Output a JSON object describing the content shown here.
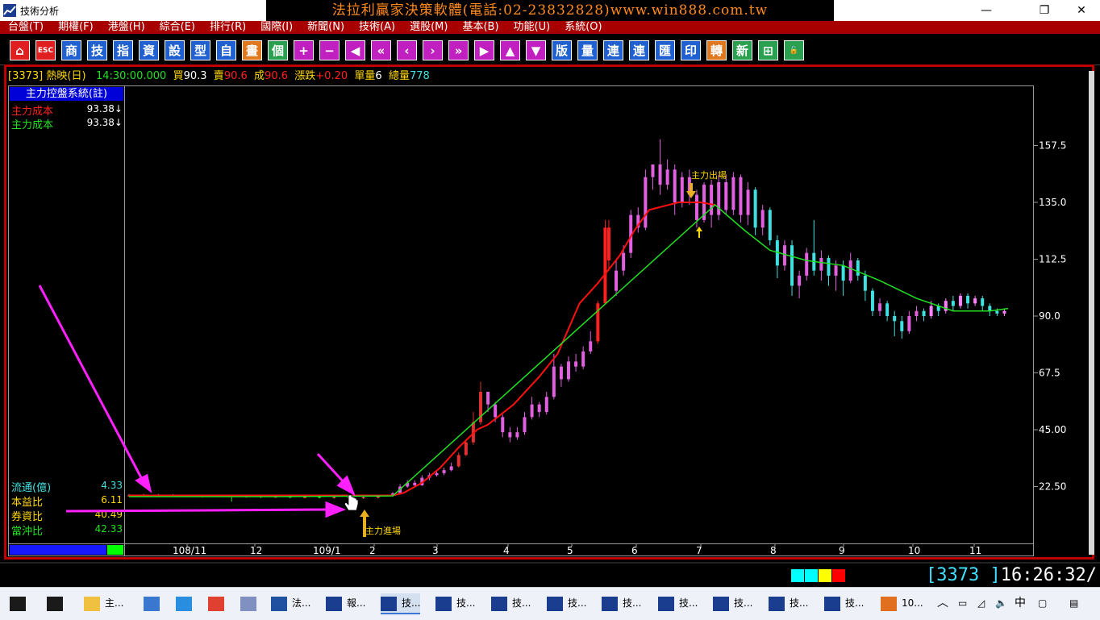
{
  "window": {
    "title": "技術分析",
    "banner": "法拉利贏家決策軟體(電話:02-23832828)www.win888.com.tw",
    "min": "—",
    "max": "❐",
    "close": "✕"
  },
  "menu": [
    "台盤(T)",
    "期權(F)",
    "港盤(H)",
    "綜合(E)",
    "排行(R)",
    "國際(I)",
    "新聞(N)",
    "技術(A)",
    "選股(M)",
    "基本(B)",
    "功能(U)",
    "系統(O)"
  ],
  "toolbar": [
    {
      "name": "home",
      "label": "⌂",
      "bg": "#e02020"
    },
    {
      "name": "esc",
      "label": "ESC",
      "bg": "#e02020"
    },
    {
      "name": "shang",
      "label": "商",
      "bg": "#2060d0"
    },
    {
      "name": "tech-list",
      "label": "技",
      "bg": "#2060d0"
    },
    {
      "name": "indicators",
      "label": "指",
      "bg": "#2060d0"
    },
    {
      "name": "zi",
      "label": "資",
      "bg": "#2060d0"
    },
    {
      "name": "settings",
      "label": "設",
      "bg": "#2060d0"
    },
    {
      "name": "pattern",
      "label": "型",
      "bg": "#2060d0"
    },
    {
      "name": "zi2",
      "label": "自",
      "bg": "#2060d0"
    },
    {
      "name": "draw",
      "label": "畫",
      "bg": "#e07820"
    },
    {
      "name": "qi",
      "label": "個",
      "bg": "#2aa050"
    },
    {
      "name": "plus",
      "label": "+",
      "bg": "#c020c0"
    },
    {
      "name": "minus",
      "label": "−",
      "bg": "#c020c0"
    },
    {
      "name": "left-end",
      "label": "◀",
      "bg": "#c020c0"
    },
    {
      "name": "fast-back",
      "label": "«",
      "bg": "#c020c0"
    },
    {
      "name": "back",
      "label": "‹",
      "bg": "#c020c0"
    },
    {
      "name": "forward",
      "label": "›",
      "bg": "#c020c0"
    },
    {
      "name": "fast-forward",
      "label": "»",
      "bg": "#c020c0"
    },
    {
      "name": "right-end",
      "label": "▶",
      "bg": "#c020c0"
    },
    {
      "name": "up",
      "label": "▲",
      "bg": "#c020c0"
    },
    {
      "name": "down",
      "label": "▼",
      "bg": "#c020c0"
    },
    {
      "name": "layout",
      "label": "版",
      "bg": "#2060d0"
    },
    {
      "name": "vol",
      "label": "量",
      "bg": "#2060d0"
    },
    {
      "name": "lian1",
      "label": "連",
      "bg": "#2060d0"
    },
    {
      "name": "lian2",
      "label": "連",
      "bg": "#2060d0"
    },
    {
      "name": "hui",
      "label": "匯",
      "bg": "#2060d0"
    },
    {
      "name": "print",
      "label": "印",
      "bg": "#2060d0"
    },
    {
      "name": "zhuan",
      "label": "轉",
      "bg": "#e07820"
    },
    {
      "name": "xin",
      "label": "新",
      "bg": "#2aa050"
    },
    {
      "name": "window",
      "label": "⊞",
      "bg": "#2aa050"
    },
    {
      "name": "lock",
      "label": "🔓",
      "bg": "#2aa050"
    }
  ],
  "quote": {
    "code": "[3373]",
    "name": "熱映",
    "period": "(日)",
    "time": "14:30:00.000",
    "bid_label": "買",
    "bid": "90.3",
    "ask_label": "賣",
    "ask": "90.6",
    "deal_label": "成",
    "deal": "90.6",
    "change_label": "漲跌",
    "change": "+0.20",
    "unit_vol_label": "單量",
    "unit_vol": "6",
    "total_vol_label": "總量",
    "total_vol": "778"
  },
  "panel": {
    "title": "主力控盤系統(註)",
    "lines": [
      {
        "label": "主力成本",
        "value": "93.38↓",
        "color": "#ff2020"
      },
      {
        "label": "主力成本",
        "value": "93.38↓",
        "color": "#20e020"
      }
    ],
    "stats": [
      {
        "label": "流通(億)",
        "value": "4.33"
      },
      {
        "label": "本益比",
        "value": "6.11"
      },
      {
        "label": "券資比",
        "value": "40.49"
      },
      {
        "label": "當沖比",
        "value": "42.33"
      }
    ]
  },
  "annotations": {
    "enter": "主力進場",
    "exit": "主力出場"
  },
  "status": {
    "code": "[3373   ]",
    "time": "16:26:32/"
  },
  "colors": {
    "menu_bg": "#a80000",
    "frame": "#bf0000",
    "up_candle": "#e060e0",
    "down_candle": "#40e0e0",
    "red_line": "#ff1010",
    "green_line": "#20e020",
    "arrow": "#ff20ff",
    "marker": "#e8b020"
  },
  "taskbar": [
    {
      "name": "start",
      "label": "",
      "icon": "windows-icon"
    },
    {
      "name": "task-view",
      "label": "",
      "icon": "task-view-icon"
    },
    {
      "name": "explorer",
      "label": "主...",
      "icon": "folder-icon"
    },
    {
      "name": "pc",
      "label": "",
      "icon": "computer-icon"
    },
    {
      "name": "ie",
      "label": "",
      "icon": "ie-icon"
    },
    {
      "name": "chrome",
      "label": "",
      "icon": "chrome-icon"
    },
    {
      "name": "tool",
      "label": "",
      "icon": "tool-icon"
    },
    {
      "name": "fa",
      "label": "法...",
      "icon": "app-icon"
    },
    {
      "name": "bao",
      "label": "報...",
      "icon": "chart-icon"
    },
    {
      "name": "ji1",
      "label": "技...",
      "icon": "chart-icon"
    },
    {
      "name": "ji2",
      "label": "技...",
      "icon": "chart-icon"
    },
    {
      "name": "ji3",
      "label": "技...",
      "icon": "chart-icon"
    },
    {
      "name": "ji4",
      "label": "技...",
      "icon": "chart-icon"
    },
    {
      "name": "ji5",
      "label": "技...",
      "icon": "chart-icon"
    },
    {
      "name": "ji6",
      "label": "技...",
      "icon": "chart-icon"
    },
    {
      "name": "ji7",
      "label": "技...",
      "icon": "chart-icon"
    },
    {
      "name": "ji8",
      "label": "技...",
      "icon": "chart-icon"
    },
    {
      "name": "ji9",
      "label": "技...",
      "icon": "chart-icon"
    },
    {
      "name": "ten",
      "label": "10...",
      "icon": "office-icon"
    }
  ],
  "tray": {
    "ime": "中"
  },
  "chart_data": {
    "type": "candlestick",
    "y_ticks": [
      "22.50",
      "45.00",
      "67.5",
      "90.0",
      "112.5",
      "135.0",
      "157.5"
    ],
    "x_ticks": [
      "108/11",
      "12",
      "109/1",
      "2",
      "3",
      "4",
      "5",
      "6",
      "7",
      "8",
      "9",
      "10",
      "11"
    ],
    "ylim": [
      0,
      180
    ],
    "grid": false,
    "legend": "none",
    "red_line": [
      [
        0,
        19
      ],
      [
        20,
        19
      ],
      [
        40,
        19
      ],
      [
        60,
        19
      ],
      [
        72,
        19
      ],
      [
        75,
        20
      ],
      [
        80,
        24
      ],
      [
        85,
        30
      ],
      [
        90,
        38
      ],
      [
        95,
        45
      ],
      [
        98,
        47
      ],
      [
        105,
        55
      ],
      [
        112,
        66
      ],
      [
        117,
        75
      ],
      [
        120,
        85
      ],
      [
        123,
        95
      ],
      [
        128,
        103
      ],
      [
        134,
        114
      ],
      [
        138,
        124
      ],
      [
        142,
        132
      ],
      [
        150,
        135
      ],
      [
        156,
        135
      ],
      [
        160,
        134
      ]
    ],
    "green_line": [
      [
        0,
        18.5
      ],
      [
        40,
        18.5
      ],
      [
        72,
        18.8
      ],
      [
        160,
        134
      ],
      [
        168,
        124
      ],
      [
        175,
        116
      ],
      [
        185,
        112
      ],
      [
        195,
        110
      ],
      [
        205,
        104
      ],
      [
        215,
        97
      ],
      [
        225,
        92
      ],
      [
        235,
        92
      ],
      [
        240,
        93
      ]
    ],
    "candles": [
      [
        0,
        19,
        19,
        19.6,
        18.6
      ],
      [
        4,
        19,
        19,
        19.6,
        18.6
      ],
      [
        8,
        19,
        19,
        19.6,
        18.6
      ],
      [
        12,
        19,
        18.8,
        19.5,
        18.4
      ],
      [
        16,
        18.8,
        18.9,
        19.3,
        18.4
      ],
      [
        20,
        18.9,
        18.7,
        19.3,
        18.2
      ],
      [
        24,
        18.7,
        18.8,
        19.2,
        18.3
      ],
      [
        28,
        18.8,
        18.5,
        19.2,
        16.5
      ],
      [
        32,
        18.5,
        18.6,
        19,
        18.1
      ],
      [
        36,
        18.6,
        18.4,
        19,
        18
      ],
      [
        40,
        18.4,
        18.5,
        18.9,
        18
      ],
      [
        44,
        18.5,
        18.3,
        18.9,
        17.9
      ],
      [
        48,
        18.3,
        18.4,
        18.8,
        17.9
      ],
      [
        52,
        18.4,
        18.2,
        18.8,
        17.8
      ],
      [
        56,
        18.2,
        18.3,
        18.7,
        17.8
      ],
      [
        60,
        18.3,
        18.1,
        18.7,
        17.7
      ],
      [
        64,
        18.1,
        18.2,
        18.6,
        17.7
      ],
      [
        68,
        18.2,
        18.8,
        19.2,
        17.8
      ],
      [
        72,
        18.8,
        19.8,
        20.3,
        18.5
      ],
      [
        74,
        19.8,
        22.5,
        23.5,
        19.5
      ],
      [
        76,
        22.5,
        24,
        25,
        22
      ],
      [
        78,
        24,
        23,
        25,
        22.5
      ],
      [
        80,
        23,
        26,
        27,
        22.8
      ],
      [
        82,
        26,
        27,
        28,
        25
      ],
      [
        84,
        27,
        27.8,
        28.5,
        26.5
      ],
      [
        86,
        27.8,
        29,
        30,
        27
      ],
      [
        88,
        29,
        30.5,
        32,
        28.5
      ],
      [
        90,
        30.5,
        35,
        36,
        30
      ],
      [
        92,
        35,
        40,
        41,
        34.5
      ],
      [
        94,
        40,
        48,
        52,
        39
      ],
      [
        96,
        48,
        60,
        64,
        47
      ],
      [
        98,
        60,
        55,
        60,
        52
      ],
      [
        100,
        55,
        50,
        56,
        48
      ],
      [
        102,
        50,
        44,
        51,
        42
      ],
      [
        104,
        44,
        42,
        46,
        40
      ],
      [
        106,
        42,
        44,
        46,
        41
      ],
      [
        108,
        44,
        50,
        52,
        43
      ],
      [
        110,
        50,
        55,
        58,
        49
      ],
      [
        112,
        55,
        52,
        56,
        50
      ],
      [
        114,
        52,
        58,
        60,
        51
      ],
      [
        116,
        58,
        70,
        75,
        57
      ],
      [
        118,
        70,
        65,
        71,
        62
      ],
      [
        120,
        65,
        72,
        74,
        64
      ],
      [
        122,
        72,
        70,
        75,
        68
      ],
      [
        124,
        70,
        76,
        78,
        69
      ],
      [
        126,
        76,
        80,
        84,
        75
      ],
      [
        128,
        80,
        95,
        96,
        79
      ],
      [
        130,
        95,
        125,
        128,
        108
      ],
      [
        131,
        125,
        112,
        128,
        108
      ],
      [
        133,
        100,
        108,
        112,
        98
      ],
      [
        135,
        108,
        115,
        118,
        106
      ],
      [
        137,
        115,
        130,
        132,
        113
      ],
      [
        139,
        130,
        125,
        133,
        123
      ],
      [
        141,
        125,
        145,
        148,
        124
      ],
      [
        143,
        145,
        150,
        150,
        140
      ],
      [
        145,
        150,
        142,
        160,
        138
      ],
      [
        147,
        142,
        148,
        152,
        140
      ],
      [
        149,
        148,
        135,
        150,
        130
      ],
      [
        151,
        135,
        145,
        147,
        133
      ],
      [
        153,
        145,
        138,
        148,
        134
      ],
      [
        155,
        138,
        128,
        140,
        125
      ],
      [
        157,
        128,
        142,
        143,
        127
      ],
      [
        159,
        142,
        130,
        144,
        125
      ],
      [
        161,
        130,
        143,
        146,
        128
      ],
      [
        163,
        143,
        132,
        146,
        130
      ],
      [
        165,
        132,
        145,
        147,
        130
      ],
      [
        167,
        145,
        130,
        146,
        127
      ],
      [
        169,
        130,
        140,
        143,
        126
      ],
      [
        171,
        140,
        125,
        141,
        122
      ],
      [
        173,
        125,
        132,
        134,
        122
      ],
      [
        175,
        132,
        120,
        133,
        118
      ],
      [
        177,
        120,
        110,
        122,
        105
      ],
      [
        179,
        110,
        118,
        120,
        108
      ],
      [
        181,
        118,
        102,
        120,
        98
      ],
      [
        183,
        102,
        106,
        108,
        97
      ],
      [
        185,
        106,
        115,
        117,
        104
      ],
      [
        187,
        115,
        108,
        128,
        106
      ],
      [
        189,
        108,
        113,
        116,
        104
      ],
      [
        191,
        113,
        106,
        114,
        102
      ],
      [
        193,
        106,
        110,
        112,
        100
      ],
      [
        195,
        110,
        104,
        112,
        98
      ],
      [
        197,
        104,
        112,
        115,
        103
      ],
      [
        199,
        112,
        106,
        113,
        104
      ],
      [
        201,
        106,
        100,
        108,
        96
      ],
      [
        203,
        100,
        92,
        101,
        90
      ],
      [
        205,
        92,
        95,
        97,
        90
      ],
      [
        207,
        95,
        90,
        96,
        88
      ],
      [
        209,
        90,
        88,
        92,
        82
      ],
      [
        211,
        88,
        84,
        90,
        81
      ],
      [
        213,
        84,
        90,
        92,
        83
      ],
      [
        215,
        90,
        92,
        94,
        88
      ],
      [
        217,
        92,
        90,
        93,
        88
      ],
      [
        219,
        90,
        94,
        96,
        89
      ],
      [
        221,
        94,
        92,
        95,
        90
      ],
      [
        223,
        92,
        96,
        97,
        91
      ],
      [
        225,
        96,
        94,
        98,
        92
      ],
      [
        227,
        94,
        98,
        99,
        93
      ],
      [
        229,
        98,
        95,
        99,
        93
      ],
      [
        231,
        95,
        97,
        98,
        94
      ],
      [
        233,
        97,
        94,
        98,
        92
      ],
      [
        235,
        94,
        92,
        95,
        90
      ],
      [
        237,
        92,
        91,
        93,
        90
      ],
      [
        239,
        91,
        92,
        93,
        90
      ]
    ]
  }
}
